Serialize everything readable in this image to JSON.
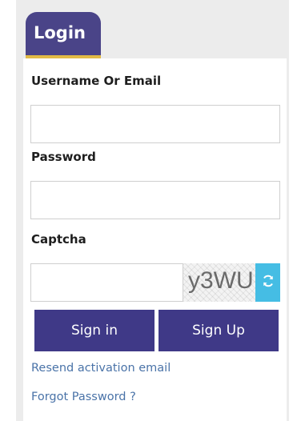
{
  "tab": {
    "label": "Login"
  },
  "form": {
    "username": {
      "label": "Username Or Email",
      "value": "",
      "placeholder": ""
    },
    "password": {
      "label": "Password",
      "value": "",
      "placeholder": ""
    },
    "captcha": {
      "label": "Captcha",
      "value": "",
      "image_text": "y3WU"
    }
  },
  "buttons": {
    "signin": "Sign in",
    "signup": "Sign Up"
  },
  "links": {
    "resend": "Resend activation email",
    "forgot": "Forgot Password ?"
  },
  "colors": {
    "primary": "#3f3987",
    "tab": "#4a4488",
    "tab_underline": "#e2ba45",
    "refresh": "#45bde4",
    "link": "#4a73a8"
  },
  "icons": {
    "refresh": "refresh-icon"
  }
}
